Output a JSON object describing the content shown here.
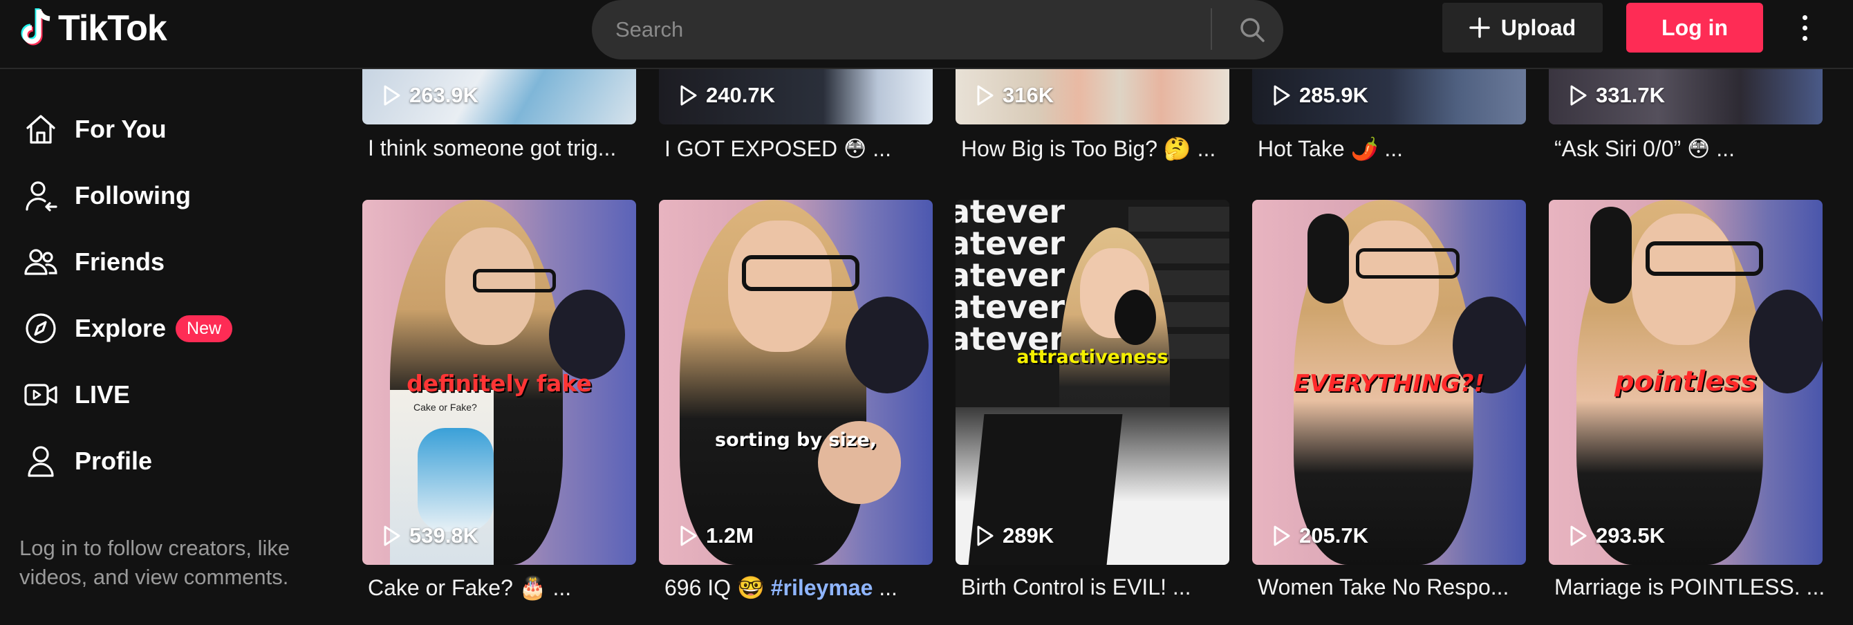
{
  "header": {
    "brand": "TikTok",
    "search_placeholder": "Search",
    "upload_label": "Upload",
    "login_label": "Log in"
  },
  "sidebar": {
    "items": [
      {
        "label": "For You",
        "icon": "home-icon"
      },
      {
        "label": "Following",
        "icon": "following-icon"
      },
      {
        "label": "Friends",
        "icon": "friends-icon"
      },
      {
        "label": "Explore",
        "icon": "compass-icon",
        "badge": "New"
      },
      {
        "label": "LIVE",
        "icon": "live-icon"
      },
      {
        "label": "Profile",
        "icon": "profile-icon"
      }
    ],
    "login_note": "Log in to follow creators, like videos, and view comments."
  },
  "videos_row1": [
    {
      "views": "263.9K",
      "caption": "I think someone got trig..."
    },
    {
      "views": "240.7K",
      "caption": "I GOT EXPOSED 😳 ..."
    },
    {
      "views": "316K",
      "caption": "How Big is Too Big? 🤔 ..."
    },
    {
      "views": "285.9K",
      "caption": "Hot Take 🌶️ ..."
    },
    {
      "views": "331.7K",
      "caption": "“Ask Siri 0/0” 😳 ..."
    }
  ],
  "videos_row2": [
    {
      "views": "539.8K",
      "caption": "Cake or Fake? 🎂 ...",
      "overlay": "definitely fake",
      "sub_overlay": "Cake or Fake?"
    },
    {
      "views": "1.2M",
      "caption_prefix": "696 IQ 🤓 ",
      "hashtag": "#rileymae",
      "caption_suffix": " ...",
      "overlay": "sorting by size,"
    },
    {
      "views": "289K",
      "caption": "Birth Control is EVIL! ...",
      "overlay": "attractiveness",
      "bg_text": "atever"
    },
    {
      "views": "205.7K",
      "caption": "Women Take No Respo...",
      "overlay": "EVERYTHING?!"
    },
    {
      "views": "293.5K",
      "caption": "Marriage is POINTLESS. ...",
      "overlay": "pointless"
    }
  ],
  "colors": {
    "accent": "#fe2c55",
    "background": "#121212",
    "hashtag": "#8fb5ff"
  }
}
